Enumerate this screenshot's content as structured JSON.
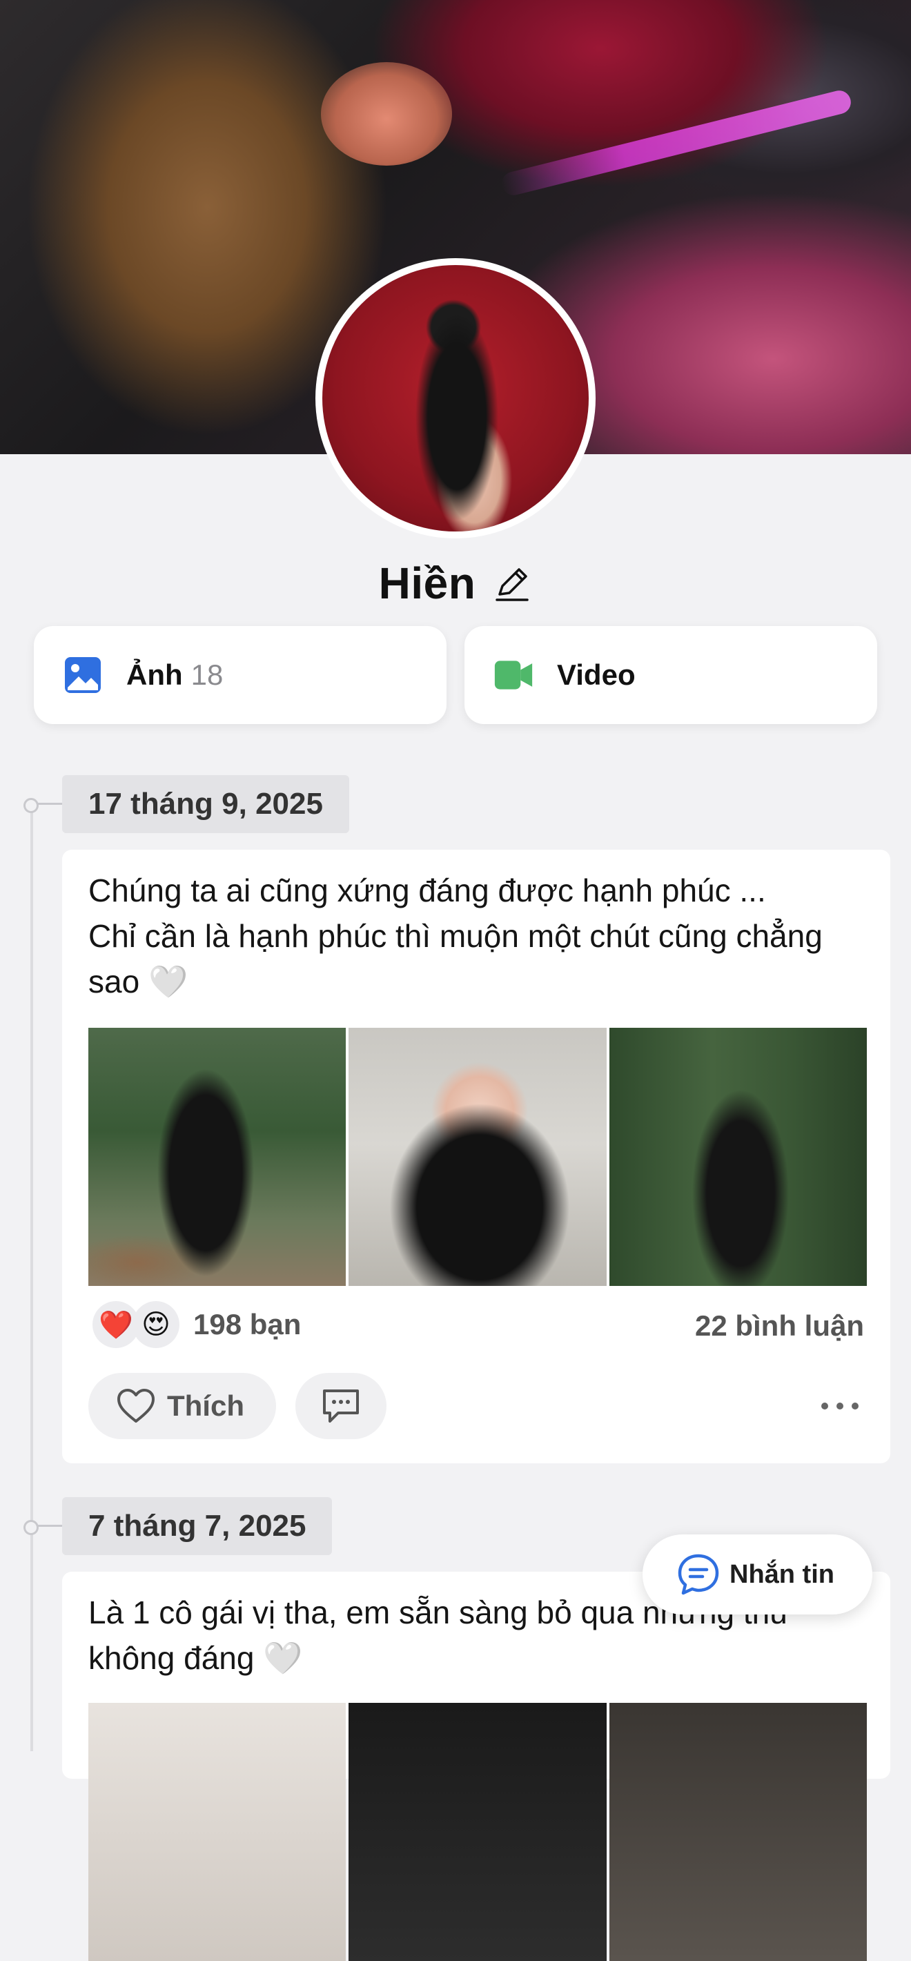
{
  "profile": {
    "name": "Hiền"
  },
  "media": {
    "photos_label": "Ảnh",
    "photos_count": "18",
    "video_label": "Video"
  },
  "colors": {
    "photo_icon": "#2f6fe0",
    "video_icon": "#4fb86a",
    "message_icon": "#2f6fe0"
  },
  "posts": [
    {
      "date": "17 tháng 9, 2025",
      "text_line1": "Chúng ta ai cũng xứng đáng được hạnh phúc ...",
      "text_line2": "Chỉ cần là hạnh phúc thì muộn một chút cũng chẳng",
      "text_line3": "sao 🤍",
      "photos_count": 3,
      "reactions": [
        "❤️",
        "😍"
      ],
      "reaction_count": "198 bạn",
      "comment_count": "22 bình luận",
      "like_label": "Thích"
    },
    {
      "date": "7 tháng 7, 2025",
      "text_line1": "Là 1 cô gái vị tha, em sẵn sàng bỏ qua những thứ",
      "text_line2": "không đáng 🤍",
      "photos_count": 3
    }
  ],
  "message_button": {
    "label": "Nhắn tin",
    "icon": "chat-bubble-icon"
  },
  "icons": {
    "edit": "pencil-icon",
    "photo": "image-icon",
    "video": "video-camera-icon",
    "like": "heart-outline-icon",
    "comment": "comment-icon",
    "more": "more-horizontal-icon"
  }
}
